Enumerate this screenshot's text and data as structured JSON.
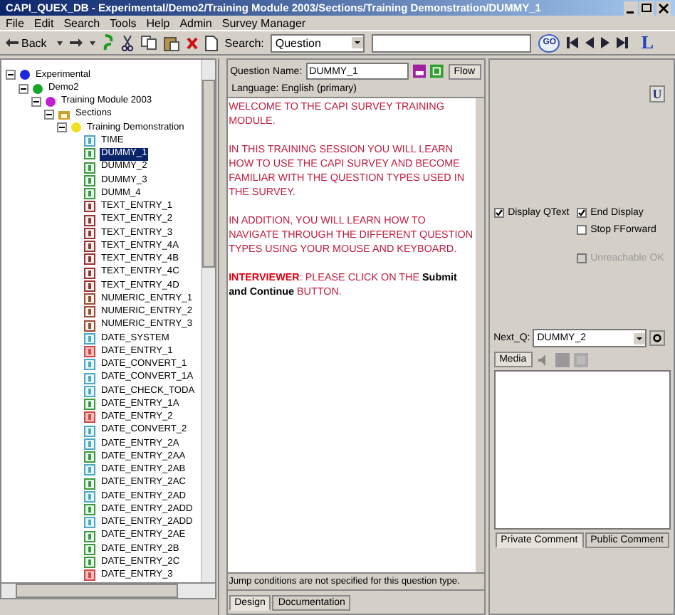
{
  "window": {
    "title": "CAPI_QUEX_DB - Experimental/Demo2/Training Module 2003/Sections/Training Demonstration/DUMMY_1"
  },
  "menu": [
    "File",
    "Edit",
    "Search",
    "Tools",
    "Help",
    "Admin",
    "Survey Manager"
  ],
  "toolbar": {
    "back_label": "Back",
    "search_label": "Search:",
    "search_scope": "Question",
    "go_label": "GO",
    "logo_label": "L"
  },
  "tree": [
    {
      "label": "Experimental",
      "kind": "project",
      "expanded": true,
      "selected": false,
      "children": [
        {
          "label": "Demo2",
          "kind": "demo",
          "expanded": true,
          "selected": false,
          "children": [
            {
              "label": "Training Module 2003",
              "kind": "module",
              "expanded": true,
              "selected": false,
              "children": [
                {
                  "label": "Sections",
                  "kind": "folder",
                  "expanded": true,
                  "selected": false,
                  "children": [
                    {
                      "label": "Training Demonstration",
                      "kind": "section",
                      "expanded": true,
                      "selected": false,
                      "children": [
                        {
                          "label": "TIME",
                          "kind": "fill",
                          "selected": false
                        },
                        {
                          "label": "DUMMY_1",
                          "kind": "dummy",
                          "selected": true
                        },
                        {
                          "label": "DUMMY_2",
                          "kind": "dummy",
                          "selected": false
                        },
                        {
                          "label": "DUMMY_3",
                          "kind": "dummy",
                          "selected": false
                        },
                        {
                          "label": "DUMM_4",
                          "kind": "dummy",
                          "selected": false
                        },
                        {
                          "label": "TEXT_ENTRY_1",
                          "kind": "text",
                          "selected": false
                        },
                        {
                          "label": "TEXT_ENTRY_2",
                          "kind": "text",
                          "selected": false
                        },
                        {
                          "label": "TEXT_ENTRY_3",
                          "kind": "text",
                          "selected": false
                        },
                        {
                          "label": "TEXT_ENTRY_4A",
                          "kind": "text",
                          "selected": false
                        },
                        {
                          "label": "TEXT_ENTRY_4B",
                          "kind": "text",
                          "selected": false
                        },
                        {
                          "label": "TEXT_ENTRY_4C",
                          "kind": "text",
                          "selected": false
                        },
                        {
                          "label": "TEXT_ENTRY_4D",
                          "kind": "text",
                          "selected": false
                        },
                        {
                          "label": "NUMERIC_ENTRY_1",
                          "kind": "numeric",
                          "selected": false
                        },
                        {
                          "label": "NUMERIC_ENTRY_2",
                          "kind": "numeric",
                          "selected": false
                        },
                        {
                          "label": "NUMERIC_ENTRY_3",
                          "kind": "numeric",
                          "selected": false
                        },
                        {
                          "label": "DATE_SYSTEM",
                          "kind": "fill",
                          "selected": false
                        },
                        {
                          "label": "DATE_ENTRY_1",
                          "kind": "date",
                          "selected": false
                        },
                        {
                          "label": "DATE_CONVERT_1",
                          "kind": "fill",
                          "selected": false
                        },
                        {
                          "label": "DATE_CONVERT_1A",
                          "kind": "fill",
                          "selected": false
                        },
                        {
                          "label": "DATE_CHECK_TODA",
                          "kind": "fill",
                          "selected": false
                        },
                        {
                          "label": "DATE_ENTRY_1A",
                          "kind": "dummy",
                          "selected": false
                        },
                        {
                          "label": "DATE_ENTRY_2",
                          "kind": "date",
                          "selected": false
                        },
                        {
                          "label": "DATE_CONVERT_2",
                          "kind": "fill",
                          "selected": false
                        },
                        {
                          "label": "DATE_ENTRY_2A",
                          "kind": "fill",
                          "selected": false
                        },
                        {
                          "label": "DATE_ENTRY_2AA",
                          "kind": "dummy",
                          "selected": false
                        },
                        {
                          "label": "DATE_ENTRY_2AB",
                          "kind": "fill",
                          "selected": false
                        },
                        {
                          "label": "DATE_ENTRY_2AC",
                          "kind": "dummy",
                          "selected": false
                        },
                        {
                          "label": "DATE_ENTRY_2AD",
                          "kind": "fill",
                          "selected": false
                        },
                        {
                          "label": "DATE_ENTRY_2ADD",
                          "kind": "dummy",
                          "selected": false
                        },
                        {
                          "label": "DATE_ENTRY_2ADD",
                          "kind": "fill",
                          "selected": false
                        },
                        {
                          "label": "DATE_ENTRY_2AE",
                          "kind": "dummy",
                          "selected": false
                        },
                        {
                          "label": "DATE_ENTRY_2B",
                          "kind": "dummy",
                          "selected": false
                        },
                        {
                          "label": "DATE_ENTRY_2C",
                          "kind": "dummy",
                          "selected": false
                        },
                        {
                          "label": "DATE_ENTRY_3",
                          "kind": "date",
                          "selected": false
                        }
                      ]
                    }
                  ]
                }
              ]
            }
          ]
        }
      ]
    }
  ],
  "question": {
    "name_label": "Question Name:",
    "name": "DUMMY_1",
    "flow_label": "Flow",
    "language": "Language: English (primary)",
    "paragraphs": [
      "WELCOME TO THE CAPI SURVEY TRAINING MODULE.",
      "IN THIS TRAINING SESSION YOU WILL LEARN HOW TO USE THE CAPI SURVEY AND BECOME FAMILIAR WITH THE QUESTION TYPES USED IN THE SURVEY.",
      "IN ADDITION, YOU WILL LEARN HOW TO NAVIGATE THROUGH THE DIFFERENT QUESTION TYPES USING YOUR MOUSE AND KEYBOARD.",
      "**INTERVIEWER**: PLEASE CLICK ON THE **Submit and Continue** BUTTON."
    ],
    "status": "Jump conditions are not specified for this question type.",
    "tabs": [
      {
        "label": "Design",
        "selected": true
      },
      {
        "label": "Documentation",
        "selected": false
      }
    ]
  },
  "options": {
    "u_label": "U",
    "checkboxes": [
      {
        "label": "Display QText",
        "checked": true,
        "disabled": false
      },
      {
        "label": "End Display",
        "checked": true,
        "disabled": false
      },
      {
        "label": "Stop FForward",
        "checked": false,
        "disabled": false
      },
      {
        "label": "Unreachable OK",
        "checked": false,
        "disabled": true
      }
    ],
    "next_label": "Next_Q:",
    "next_value": "DUMMY_2",
    "media_label": "Media",
    "comment_tabs": [
      {
        "label": "Private Comment",
        "selected": true
      },
      {
        "label": "Public Comment",
        "selected": false
      }
    ]
  }
}
